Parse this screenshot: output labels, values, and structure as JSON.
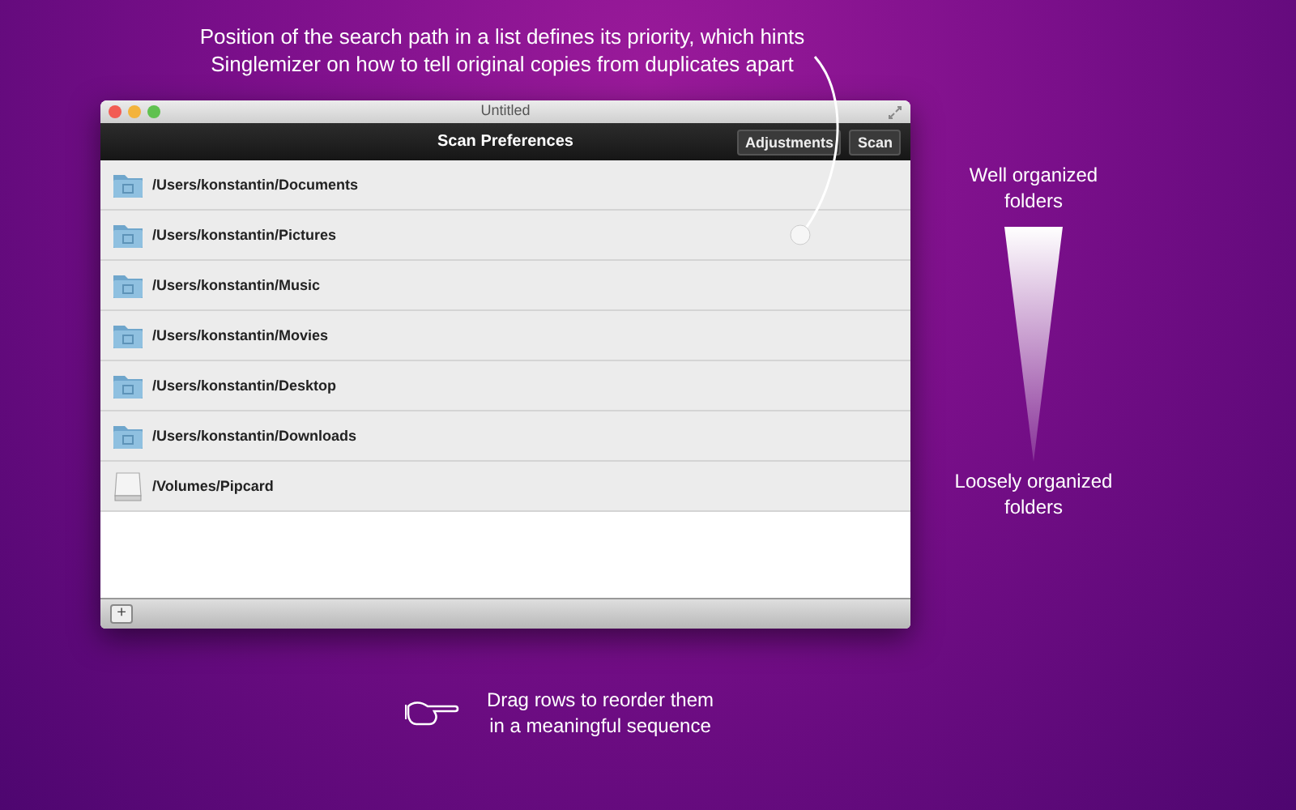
{
  "caption_top": "Position of the search path in a list defines its priority, which hints Singlemizer on how to tell original copies from duplicates apart",
  "window": {
    "title": "Untitled",
    "toolbar_title": "Scan Preferences",
    "buttons": [
      "Adjustments",
      "Scan"
    ],
    "rows": [
      {
        "kind": "folder",
        "path": "/Users/konstantin/Documents"
      },
      {
        "kind": "folder",
        "path": "/Users/konstantin/Pictures"
      },
      {
        "kind": "folder",
        "path": "/Users/konstantin/Music"
      },
      {
        "kind": "folder",
        "path": "/Users/konstantin/Movies"
      },
      {
        "kind": "folder",
        "path": "/Users/konstantin/Desktop"
      },
      {
        "kind": "folder",
        "path": "/Users/konstantin/Downloads"
      },
      {
        "kind": "drive",
        "path": "/Volumes/Pipcard"
      }
    ],
    "add_button": "+"
  },
  "legend": {
    "top": "Well organized folders",
    "bottom": "Loosely organized folders"
  },
  "caption_bottom": "Drag rows to reorder them in a meaningful sequence"
}
